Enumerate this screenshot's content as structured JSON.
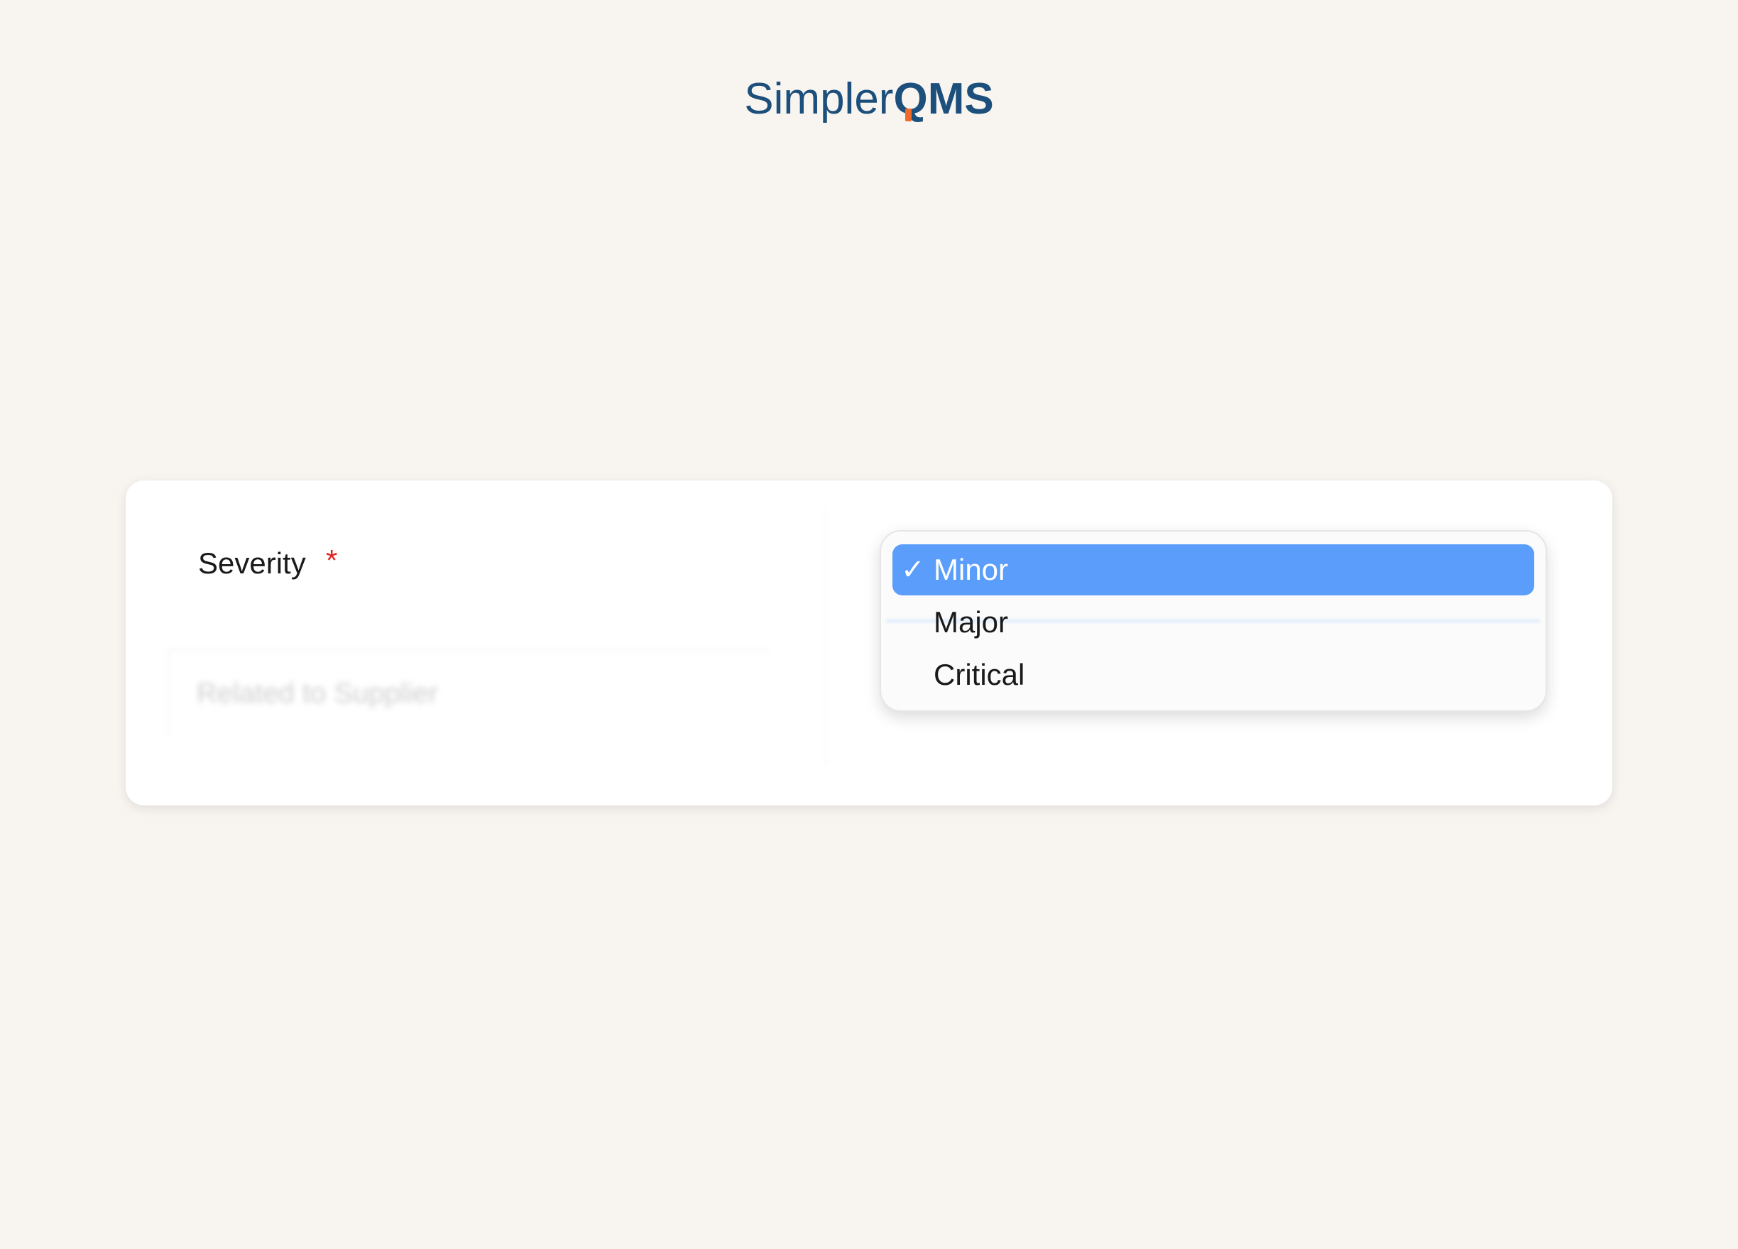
{
  "logo": {
    "part1": "Simpler",
    "part2": "QMS"
  },
  "form": {
    "field_label": "Severity",
    "required_marker": "*",
    "ghost_placeholder": "Related to Supplier"
  },
  "dropdown": {
    "selected_value": "Minor",
    "check_glyph": "✓",
    "options": [
      {
        "label": "Minor",
        "selected": true
      },
      {
        "label": "Major",
        "selected": false
      },
      {
        "label": "Critical",
        "selected": false
      }
    ]
  },
  "colors": {
    "brand": "#1d4f7c",
    "brand_accent": "#f26a2b",
    "selection": "#5a9dfb",
    "required": "#e02424",
    "background": "#f8f5f1"
  }
}
